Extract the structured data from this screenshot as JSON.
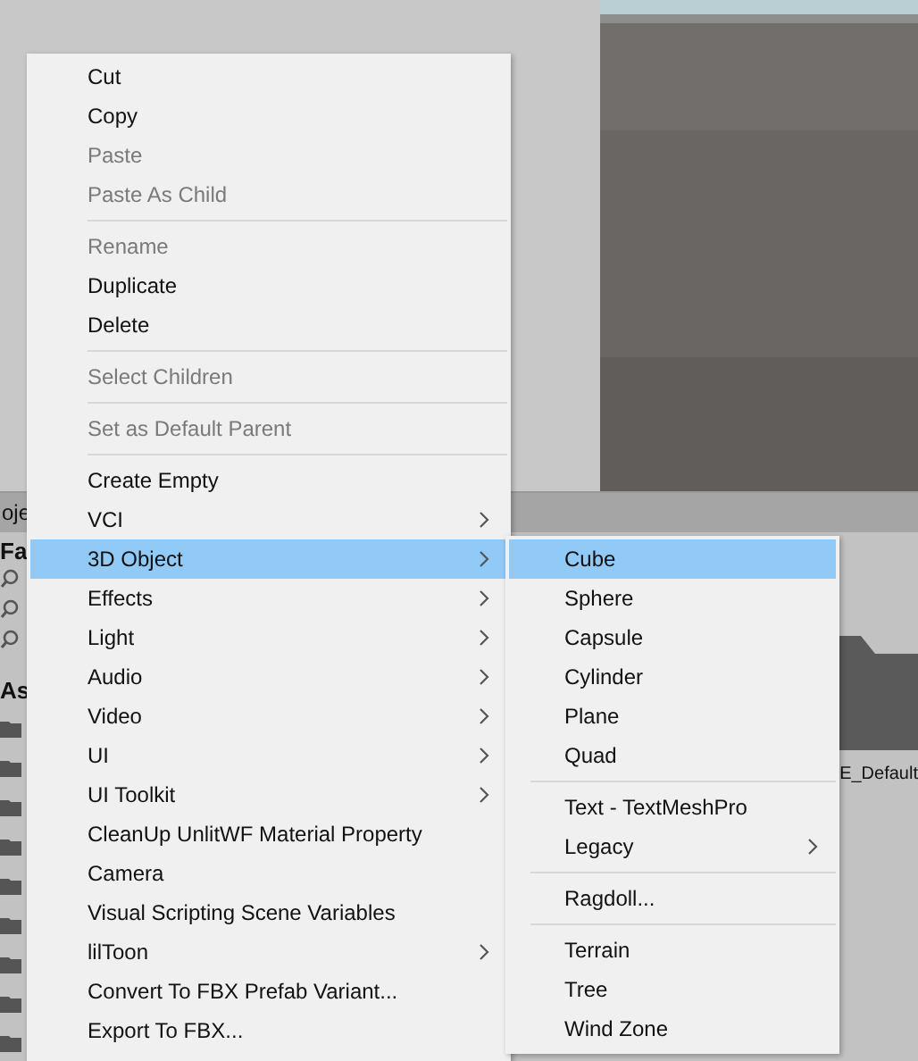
{
  "project_panel": {
    "tab": "oje",
    "favorites_label": "Fa",
    "assets_label": "As",
    "asset_name": "E_Default"
  },
  "context_menu": [
    {
      "kind": "item",
      "label": "Cut",
      "disabled": false,
      "submenu": false,
      "selected": false
    },
    {
      "kind": "item",
      "label": "Copy",
      "disabled": false,
      "submenu": false,
      "selected": false
    },
    {
      "kind": "item",
      "label": "Paste",
      "disabled": true,
      "submenu": false,
      "selected": false
    },
    {
      "kind": "item",
      "label": "Paste As Child",
      "disabled": true,
      "submenu": false,
      "selected": false
    },
    {
      "kind": "separator"
    },
    {
      "kind": "item",
      "label": "Rename",
      "disabled": true,
      "submenu": false,
      "selected": false
    },
    {
      "kind": "item",
      "label": "Duplicate",
      "disabled": false,
      "submenu": false,
      "selected": false
    },
    {
      "kind": "item",
      "label": "Delete",
      "disabled": false,
      "submenu": false,
      "selected": false
    },
    {
      "kind": "separator"
    },
    {
      "kind": "item",
      "label": "Select Children",
      "disabled": true,
      "submenu": false,
      "selected": false
    },
    {
      "kind": "separator"
    },
    {
      "kind": "item",
      "label": "Set as Default Parent",
      "disabled": true,
      "submenu": false,
      "selected": false
    },
    {
      "kind": "separator"
    },
    {
      "kind": "item",
      "label": "Create Empty",
      "disabled": false,
      "submenu": false,
      "selected": false
    },
    {
      "kind": "item",
      "label": "VCI",
      "disabled": false,
      "submenu": true,
      "selected": false
    },
    {
      "kind": "item",
      "label": "3D Object",
      "disabled": false,
      "submenu": true,
      "selected": true
    },
    {
      "kind": "item",
      "label": "Effects",
      "disabled": false,
      "submenu": true,
      "selected": false
    },
    {
      "kind": "item",
      "label": "Light",
      "disabled": false,
      "submenu": true,
      "selected": false
    },
    {
      "kind": "item",
      "label": "Audio",
      "disabled": false,
      "submenu": true,
      "selected": false
    },
    {
      "kind": "item",
      "label": "Video",
      "disabled": false,
      "submenu": true,
      "selected": false
    },
    {
      "kind": "item",
      "label": "UI",
      "disabled": false,
      "submenu": true,
      "selected": false
    },
    {
      "kind": "item",
      "label": "UI Toolkit",
      "disabled": false,
      "submenu": true,
      "selected": false
    },
    {
      "kind": "item",
      "label": "CleanUp UnlitWF Material Property",
      "disabled": false,
      "submenu": false,
      "selected": false
    },
    {
      "kind": "item",
      "label": "Camera",
      "disabled": false,
      "submenu": false,
      "selected": false
    },
    {
      "kind": "item",
      "label": "Visual Scripting Scene Variables",
      "disabled": false,
      "submenu": false,
      "selected": false
    },
    {
      "kind": "item",
      "label": "lilToon",
      "disabled": false,
      "submenu": true,
      "selected": false
    },
    {
      "kind": "item",
      "label": "Convert To FBX Prefab Variant...",
      "disabled": false,
      "submenu": false,
      "selected": false
    },
    {
      "kind": "item",
      "label": "Export To FBX...",
      "disabled": false,
      "submenu": false,
      "selected": false
    }
  ],
  "submenu": [
    {
      "kind": "item",
      "label": "Cube",
      "disabled": false,
      "submenu": false,
      "selected": true
    },
    {
      "kind": "item",
      "label": "Sphere",
      "disabled": false,
      "submenu": false,
      "selected": false
    },
    {
      "kind": "item",
      "label": "Capsule",
      "disabled": false,
      "submenu": false,
      "selected": false
    },
    {
      "kind": "item",
      "label": "Cylinder",
      "disabled": false,
      "submenu": false,
      "selected": false
    },
    {
      "kind": "item",
      "label": "Plane",
      "disabled": false,
      "submenu": false,
      "selected": false
    },
    {
      "kind": "item",
      "label": "Quad",
      "disabled": false,
      "submenu": false,
      "selected": false
    },
    {
      "kind": "separator"
    },
    {
      "kind": "item",
      "label": "Text - TextMeshPro",
      "disabled": false,
      "submenu": false,
      "selected": false
    },
    {
      "kind": "item",
      "label": "Legacy",
      "disabled": false,
      "submenu": true,
      "selected": false
    },
    {
      "kind": "separator"
    },
    {
      "kind": "item",
      "label": "Ragdoll...",
      "disabled": false,
      "submenu": false,
      "selected": false
    },
    {
      "kind": "separator"
    },
    {
      "kind": "item",
      "label": "Terrain",
      "disabled": false,
      "submenu": false,
      "selected": false
    },
    {
      "kind": "item",
      "label": "Tree",
      "disabled": false,
      "submenu": false,
      "selected": false
    },
    {
      "kind": "item",
      "label": "Wind Zone",
      "disabled": false,
      "submenu": false,
      "selected": false
    }
  ]
}
